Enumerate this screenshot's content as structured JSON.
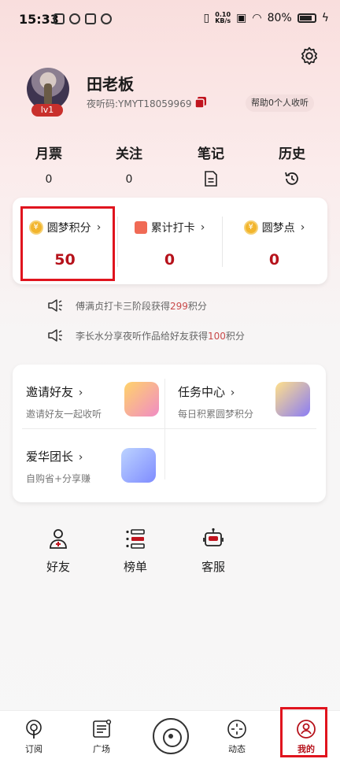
{
  "status_bar": {
    "time": "15:33",
    "speed_top": "0.10",
    "speed_bottom": "KB/s",
    "battery": "80%"
  },
  "profile": {
    "name": "田老板",
    "id_text": "夜听码:YMYT18059969",
    "level": "lv1",
    "help_text": "帮助0个人收听"
  },
  "stats": [
    {
      "label": "月票",
      "value": "0"
    },
    {
      "label": "关注",
      "value": "0"
    },
    {
      "label": "笔记",
      "icon": "note-icon"
    },
    {
      "label": "历史",
      "icon": "history-icon"
    }
  ],
  "points": [
    {
      "label": "圆梦积分",
      "value": "50",
      "icon": "coin-icon",
      "coin_text": "¥"
    },
    {
      "label": "累计打卡",
      "value": "0",
      "icon": "calendar-icon"
    },
    {
      "label": "圆梦点",
      "value": "0",
      "icon": "coin-icon",
      "coin_text": "¥"
    }
  ],
  "notices": [
    {
      "prefix": "傅满贞打卡三阶段获得",
      "highlight": "299",
      "suffix": "积分"
    },
    {
      "prefix": "李长水分享夜听作品给好友获得",
      "highlight": "100",
      "suffix": "积分"
    }
  ],
  "services": [
    {
      "title": "邀请好友",
      "subtitle": "邀请好友一起收听"
    },
    {
      "title": "任务中心",
      "subtitle": "每日积累圆梦积分"
    },
    {
      "title": "爱华团长",
      "subtitle": "自购省+分享赚"
    }
  ],
  "tools": [
    {
      "label": "好友"
    },
    {
      "label": "榜单"
    },
    {
      "label": "客服"
    }
  ],
  "nav": [
    {
      "label": "订阅"
    },
    {
      "label": "广场"
    },
    {
      "label": "动态"
    },
    {
      "label": "我的"
    }
  ],
  "colors": {
    "accent": "#b6121b",
    "highlight_box": "#e0141e"
  }
}
